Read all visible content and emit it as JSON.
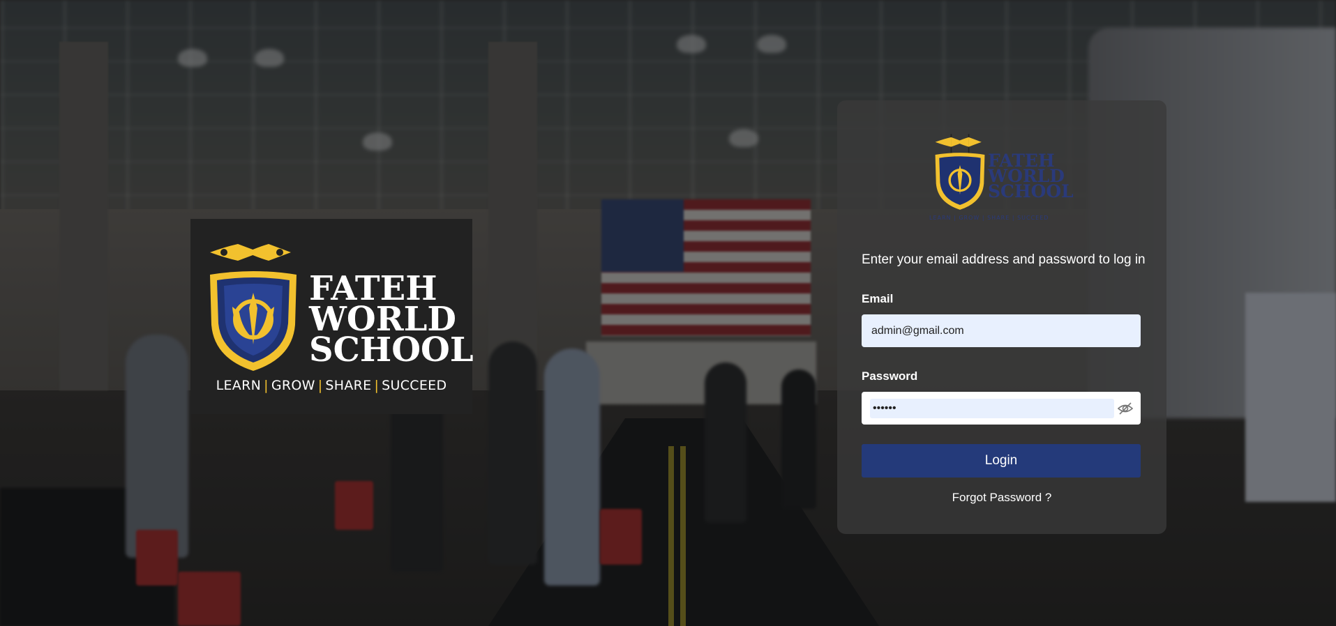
{
  "brand": {
    "name_lines": [
      "FATEH",
      "WORLD",
      "SCHOOL"
    ],
    "tagline_words": [
      "LEARN",
      "GROW",
      "SHARE",
      "SUCCEED"
    ],
    "tagline_separator": "|",
    "colors": {
      "navy": "#243a7a",
      "gold": "#f2c12e",
      "logo_card_bg": "#222222"
    }
  },
  "login": {
    "instruction": "Enter your email address and password to log in",
    "email_label": "Email",
    "email_value": "admin@gmail.com",
    "password_label": "Password",
    "password_value": "••••••",
    "toggle_icon": "eye-slash-icon",
    "login_button": "Login",
    "forgot_password": "Forgot Password ?"
  }
}
